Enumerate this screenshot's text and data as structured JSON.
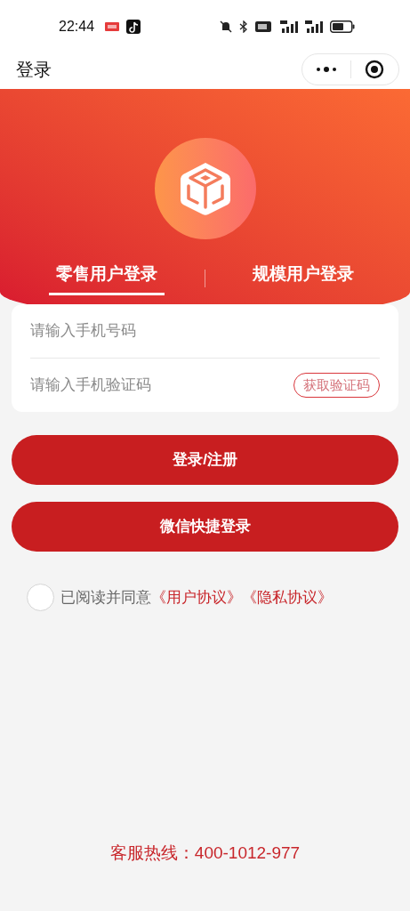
{
  "status_bar": {
    "time": "22:44"
  },
  "title_bar": {
    "title": "登录"
  },
  "tabs": [
    {
      "label": "零售用户登录",
      "selected": true
    },
    {
      "label": "规模用户登录",
      "selected": false
    }
  ],
  "form": {
    "phone": {
      "placeholder": "请输入手机号码"
    },
    "code": {
      "placeholder": "请输入手机验证码"
    },
    "code_button": "获取验证码"
  },
  "buttons": [
    "登录/注册",
    "微信快捷登录"
  ],
  "agreement": {
    "checked": false,
    "text": "已阅读并同意",
    "links": [
      "《用户协议》",
      "《隐私协议》"
    ]
  },
  "hotline": "客服热线：400-1012-977"
}
